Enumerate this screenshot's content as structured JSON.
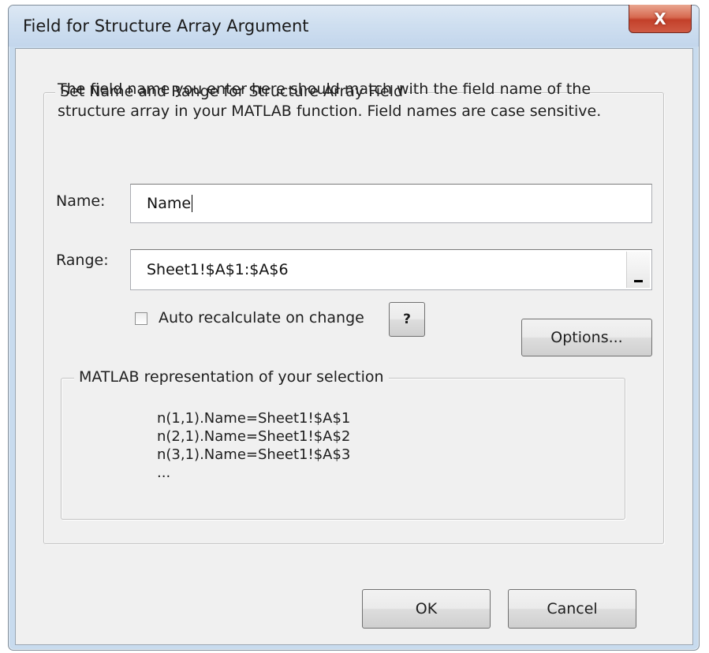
{
  "window": {
    "title": "Field for Structure Array Argument",
    "close_label": "X"
  },
  "group": {
    "legend": "Set Name and Range for Structure Array Field",
    "description": "The field name you enter here should match with the field name of the structure array in your MATLAB function. Field names are case sensitive."
  },
  "name_field": {
    "label": "Name:",
    "value": "Name"
  },
  "range_field": {
    "label": "Range:",
    "value": "Sheet1!$A$1:$A$6"
  },
  "auto_recalc": {
    "label": "Auto recalculate on change",
    "checked": false
  },
  "help_button": {
    "label": "?"
  },
  "options_button": {
    "label": "Options..."
  },
  "matlab_group": {
    "legend": "MATLAB representation of your selection",
    "lines": [
      "n(1,1).Name=Sheet1!$A$1",
      "n(2,1).Name=Sheet1!$A$2",
      "n(3,1).Name=Sheet1!$A$3",
      "..."
    ]
  },
  "footer": {
    "ok_label": "OK",
    "cancel_label": "Cancel"
  }
}
